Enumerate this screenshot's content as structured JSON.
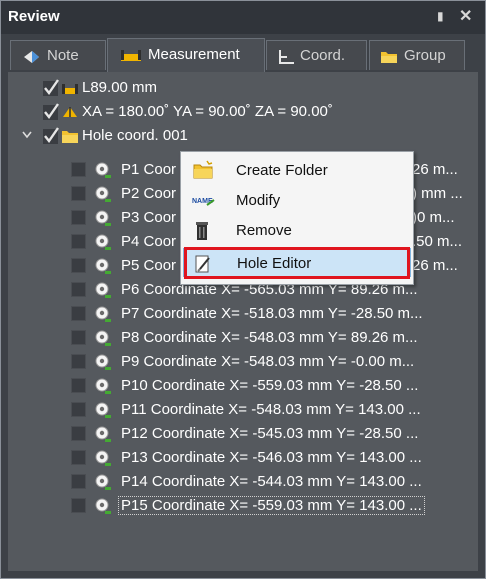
{
  "panel": {
    "title": "Review",
    "pin_icon": "pin-icon",
    "close_icon": "close-icon"
  },
  "tabs": [
    {
      "label": "Note",
      "icon": "note-icon",
      "active": false
    },
    {
      "label": "Measurement",
      "icon": "ruler-icon",
      "active": true
    },
    {
      "label": "Coord.",
      "icon": "axes-icon",
      "active": false
    },
    {
      "label": "Group",
      "icon": "folder-icon",
      "active": false
    }
  ],
  "tree": {
    "top_items": [
      {
        "label": "L89.00 mm",
        "checked": true,
        "icon": "ruler-icon"
      },
      {
        "label": "XA = 180.00˚ YA = 90.00˚ ZA = 90.00˚",
        "checked": true,
        "icon": "angle-icon"
      },
      {
        "label": "Hole coord. 001",
        "checked": true,
        "icon": "folder-icon",
        "expanded": true
      }
    ],
    "children": [
      {
        "label": "P1 Coor",
        "tail": "26 m..."
      },
      {
        "label": "P2 Coor",
        "tail": ") mm ..."
      },
      {
        "label": "P3 Coor",
        "tail": ")0 m..."
      },
      {
        "label": "P4 Coor",
        "tail": ".50 m..."
      },
      {
        "label": "P5 Coor",
        "tail": "26 m..."
      },
      {
        "label": "P6 Coordinate  X= -565.03 mm  Y= 89.26 m..."
      },
      {
        "label": "P7 Coordinate  X= -518.03 mm  Y= -28.50 m..."
      },
      {
        "label": "P8 Coordinate  X= -548.03 mm  Y= 89.26 m..."
      },
      {
        "label": "P9 Coordinate  X= -548.03 mm  Y= -0.00 m..."
      },
      {
        "label": "P10 Coordinate  X= -559.03 mm  Y= -28.50 ..."
      },
      {
        "label": "P11 Coordinate  X= -548.03 mm  Y= 143.00 ..."
      },
      {
        "label": "P12 Coordinate  X= -545.03 mm  Y= -28.50 ..."
      },
      {
        "label": "P13 Coordinate  X= -546.03 mm  Y= 143.00 ..."
      },
      {
        "label": "P14 Coordinate  X= -544.03 mm  Y= 143.00 ..."
      },
      {
        "label": "P15 Coordinate  X= -559.03 mm  Y= 143.00 ..."
      }
    ]
  },
  "context_menu": {
    "items": [
      {
        "label": "Create Folder",
        "icon": "new-folder-icon"
      },
      {
        "label": "Modify",
        "icon": "rename-icon"
      },
      {
        "label": "Remove",
        "icon": "trash-icon"
      },
      {
        "label": "Hole Editor",
        "icon": "edit-icon",
        "highlighted": true
      }
    ]
  },
  "colors": {
    "highlight_box": "#e0151f",
    "menu_hover": "#cce4f7",
    "tree_bg": "#55595e"
  }
}
